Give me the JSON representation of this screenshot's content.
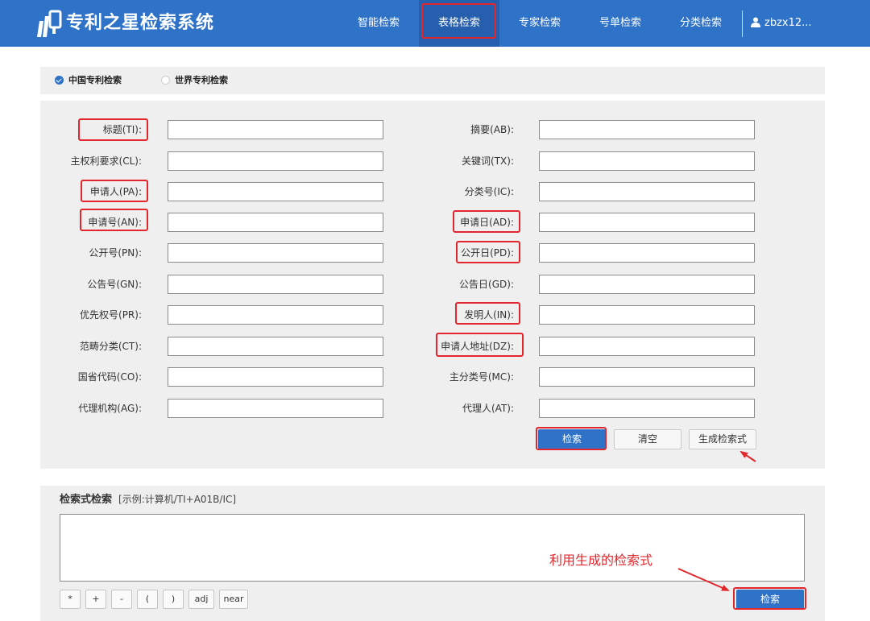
{
  "header": {
    "brand": "专利之星检索系统",
    "nav": [
      {
        "label": "智能检索",
        "active": false
      },
      {
        "label": "表格检索",
        "active": true
      },
      {
        "label": "专家检索",
        "active": false
      },
      {
        "label": "号单检索",
        "active": false
      },
      {
        "label": "分类检索",
        "active": false
      }
    ],
    "user": "zbzx12..."
  },
  "scope": {
    "options": [
      {
        "label": "中国专利检索",
        "selected": true
      },
      {
        "label": "世界专利检索",
        "selected": false
      }
    ]
  },
  "form": {
    "left": [
      {
        "label": "标题(TI):",
        "value": "",
        "highlighted": true
      },
      {
        "label": "主权利要求(CL):",
        "value": "",
        "highlighted": false
      },
      {
        "label": "申请人(PA):",
        "value": "",
        "highlighted": true
      },
      {
        "label": "申请号(AN):",
        "value": "",
        "highlighted": true
      },
      {
        "label": "公开号(PN):",
        "value": "",
        "highlighted": false
      },
      {
        "label": "公告号(GN):",
        "value": "",
        "highlighted": false
      },
      {
        "label": "优先权号(PR):",
        "value": "",
        "highlighted": false
      },
      {
        "label": "范畴分类(CT):",
        "value": "",
        "highlighted": false
      },
      {
        "label": "国省代码(CO):",
        "value": "",
        "highlighted": false
      },
      {
        "label": "代理机构(AG):",
        "value": "",
        "highlighted": false
      }
    ],
    "right": [
      {
        "label": "摘要(AB):",
        "value": "",
        "highlighted": false
      },
      {
        "label": "关键词(TX):",
        "value": "",
        "highlighted": false
      },
      {
        "label": "分类号(IC):",
        "value": "",
        "highlighted": false
      },
      {
        "label": "申请日(AD):",
        "value": "",
        "highlighted": true
      },
      {
        "label": "公开日(PD):",
        "value": "",
        "highlighted": true
      },
      {
        "label": "公告日(GD):",
        "value": "",
        "highlighted": false
      },
      {
        "label": "发明人(IN):",
        "value": "",
        "highlighted": true
      },
      {
        "label": "申请人地址(DZ):",
        "value": "",
        "highlighted": true
      },
      {
        "label": "主分类号(MC):",
        "value": "",
        "highlighted": false
      },
      {
        "label": "代理人(AT):",
        "value": "",
        "highlighted": false
      }
    ],
    "buttons": {
      "search": "检索",
      "clear": "清空",
      "generate": "生成检索式"
    }
  },
  "expression": {
    "title": "检索式检索",
    "example": "[示例:计算机/TI+A01B/IC]",
    "value": "",
    "operators": [
      "*",
      "+",
      "-",
      "(",
      ")",
      "adj",
      "near"
    ],
    "search": "检索",
    "annotation": "利用生成的检索式"
  },
  "colors": {
    "primary": "#2f73c9",
    "highlight": "#e3262c",
    "panel": "#efefef"
  }
}
